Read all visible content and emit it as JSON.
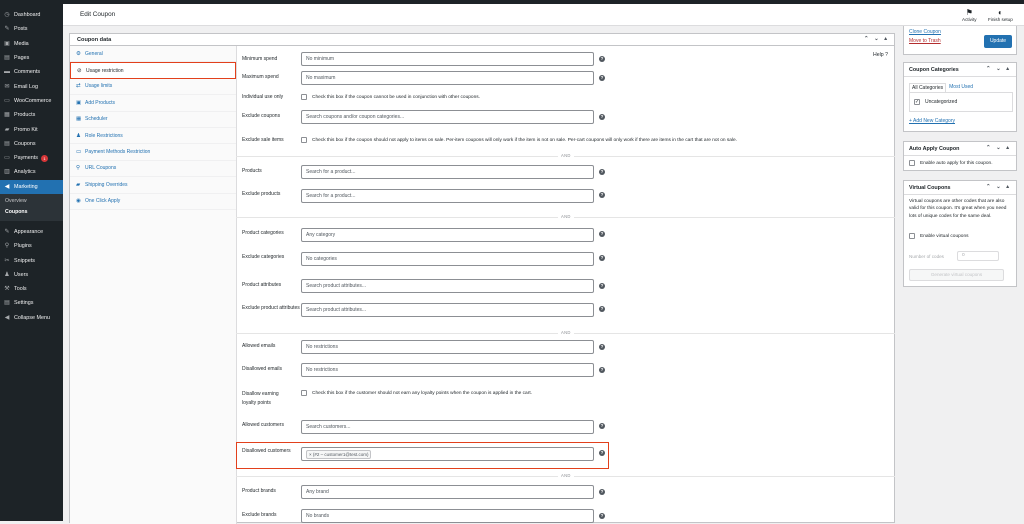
{
  "sidebar": {
    "items": [
      {
        "label": "Dashboard",
        "icon": "dashboard-icon",
        "glyph": "◷"
      },
      {
        "label": "Posts",
        "icon": "pin-icon",
        "glyph": "✎"
      },
      {
        "label": "Media",
        "icon": "media-icon",
        "glyph": "▣"
      },
      {
        "label": "Pages",
        "icon": "pages-icon",
        "glyph": "▤"
      },
      {
        "label": "Comments",
        "icon": "comments-icon",
        "glyph": "▬"
      },
      {
        "label": "Email Log",
        "icon": "email-icon",
        "glyph": "✉"
      },
      {
        "label": "WooCommerce",
        "icon": "woocommerce-icon",
        "glyph": "▭"
      },
      {
        "label": "Products",
        "icon": "products-icon",
        "glyph": "▦"
      },
      {
        "label": "Promo Kit",
        "icon": "promo-icon",
        "glyph": "▰"
      },
      {
        "label": "Coupons",
        "icon": "coupons-icon",
        "glyph": "▤"
      },
      {
        "label": "Payments",
        "icon": "payments-icon",
        "glyph": "▭",
        "badge": "1"
      },
      {
        "label": "Analytics",
        "icon": "analytics-icon",
        "glyph": "▥"
      },
      {
        "label": "Marketing",
        "icon": "marketing-icon",
        "glyph": "◀"
      }
    ],
    "submenu": [
      "Overview",
      "Coupons"
    ],
    "items2": [
      {
        "label": "Appearance",
        "icon": "appearance-icon",
        "glyph": "✎"
      },
      {
        "label": "Plugins",
        "icon": "plugins-icon",
        "glyph": "⚲"
      },
      {
        "label": "Snippets",
        "icon": "snippets-icon",
        "glyph": "✂"
      },
      {
        "label": "Users",
        "icon": "users-icon",
        "glyph": "♟"
      },
      {
        "label": "Tools",
        "icon": "tools-icon",
        "glyph": "⚒"
      },
      {
        "label": "Settings",
        "icon": "settings-icon",
        "glyph": "▤"
      },
      {
        "label": "Collapse Menu",
        "icon": "collapse-icon",
        "glyph": "◀"
      }
    ]
  },
  "header": {
    "title": "Edit Coupon",
    "activity": "Activity",
    "finish_setup": "Finish setup"
  },
  "coupon_data": {
    "title": "Coupon data",
    "help": "Help",
    "tabs": [
      {
        "label": "General",
        "glyph": "⚙"
      },
      {
        "label": "Usage restriction",
        "glyph": "⊘"
      },
      {
        "label": "Usage limits",
        "glyph": "⇄"
      },
      {
        "label": "Add Products",
        "glyph": "▣"
      },
      {
        "label": "Scheduler",
        "glyph": "▦"
      },
      {
        "label": "Role Restrictions",
        "glyph": "♟"
      },
      {
        "label": "Payment Methods Restriction",
        "glyph": "▭"
      },
      {
        "label": "URL Coupons",
        "glyph": "⚲"
      },
      {
        "label": "Shipping Overrides",
        "glyph": "▰"
      },
      {
        "label": "One Click Apply",
        "glyph": "◉"
      }
    ],
    "fields": {
      "minimum_spend": {
        "label": "Minimum spend",
        "placeholder": "No minimum"
      },
      "maximum_spend": {
        "label": "Maximum spend",
        "placeholder": "No maximum"
      },
      "individual_use": {
        "label": "Individual use only",
        "text": "Check this box if the coupon cannot be used in conjunction with other coupons."
      },
      "exclude_coupons": {
        "label": "Exclude coupons",
        "placeholder": "Search coupons and/or coupon categories..."
      },
      "exclude_sale": {
        "label": "Exclude sale items",
        "text": "Check this box if the coupon should not apply to items on sale. Per-item coupons will only work if the item is not on sale. Per-cart coupons will only work if there are items in the cart that are not on sale."
      },
      "products": {
        "label": "Products",
        "placeholder": "Search for a product..."
      },
      "exclude_products": {
        "label": "Exclude products",
        "placeholder": "Search for a product..."
      },
      "product_categories": {
        "label": "Product categories",
        "placeholder": "Any category"
      },
      "exclude_categories": {
        "label": "Exclude categories",
        "placeholder": "No categories"
      },
      "product_attributes": {
        "label": "Product attributes",
        "placeholder": "Search product attributes..."
      },
      "exclude_attributes": {
        "label": "Exclude product attributes",
        "placeholder": "Search product attributes..."
      },
      "allowed_emails": {
        "label": "Allowed emails",
        "placeholder": "No restrictions"
      },
      "disallowed_emails": {
        "label": "Disallowed emails",
        "placeholder": "No restrictions"
      },
      "disallow_loyalty": {
        "label1": "Disallow earning",
        "label2": "loyalty points",
        "text": "Check this box if the customer should not earn any loyalty points when the coupon is applied in the cart."
      },
      "allowed_customers": {
        "label": "Allowed customers",
        "placeholder": "Search customers..."
      },
      "disallowed_customers": {
        "label": "Disallowed customers",
        "chip": "× (#2 – customer1@test.com)"
      },
      "product_brands": {
        "label": "Product brands",
        "placeholder": "Any brand"
      },
      "exclude_brands": {
        "label": "Exclude brands",
        "placeholder": "No brands"
      }
    },
    "and": "AND"
  },
  "publish": {
    "clone": "Clone Coupon",
    "trash": "Move to Trash",
    "update": "Update"
  },
  "categories": {
    "title": "Coupon Categories",
    "tab_all": "All Categories",
    "tab_most": "Most Used",
    "item": "Uncategorized",
    "add": "+ Add New Category"
  },
  "auto_apply": {
    "title": "Auto Apply Coupon",
    "text": "Enable auto apply for this coupon."
  },
  "virtual": {
    "title": "Virtual Coupons",
    "desc": "Virtual coupons are other codes that are also valid for this coupon. It's great when you need lots of unique codes for the same deal.",
    "enable": "Enable virtual coupons",
    "num_label": "Number of codes",
    "num_value": "0",
    "generate": "Generate virtual coupons"
  }
}
